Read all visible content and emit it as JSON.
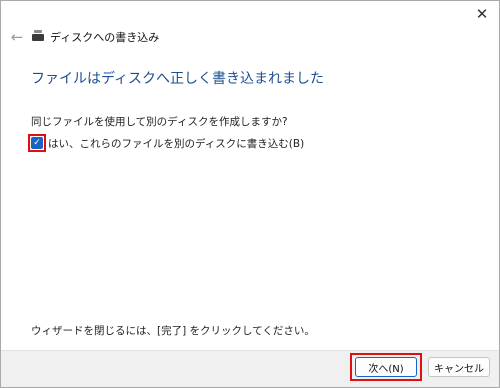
{
  "window": {
    "title": "ディスクへの書き込み",
    "close_glyph": "✕",
    "back_glyph": "←"
  },
  "content": {
    "heading": "ファイルはディスクへ正しく書き込まれました",
    "question": "同じファイルを使用して別のディスクを作成しますか?",
    "checkbox_label": "はい、これらのファイルを別のディスクに書き込む(B)",
    "checkbox_checked": true,
    "checkbox_glyph": "✓",
    "footer_text": "ウィザードを閉じるには、[完了] をクリックしてください。"
  },
  "buttons": {
    "next_label": "次へ(N)",
    "cancel_label": "キャンセル"
  },
  "colors": {
    "heading": "#1d4f91",
    "accent": "#1764c4",
    "highlight": "#e01010"
  },
  "icons": {
    "close": "close-icon",
    "back": "back-arrow-icon",
    "drive": "disc-drive-icon",
    "check": "checkmark-icon"
  }
}
